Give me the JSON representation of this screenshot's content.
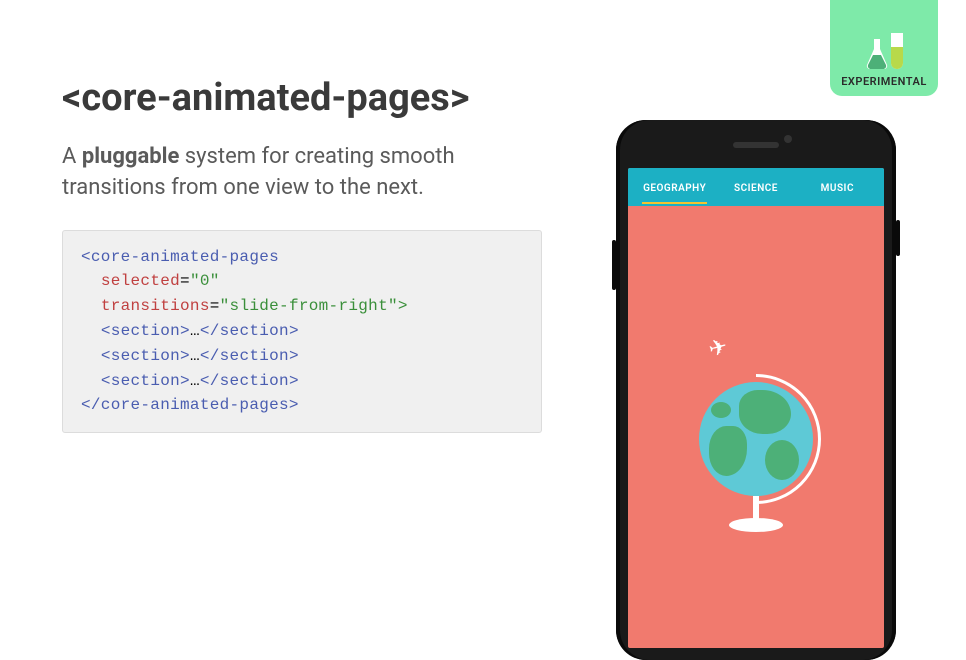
{
  "badge": {
    "label": "EXPERIMENTAL"
  },
  "heading": "<core-animated-pages>",
  "subtitle_prefix": "A ",
  "subtitle_bold": "pluggable",
  "subtitle_suffix": " system for creating smooth transitions from one view to the next.",
  "code": {
    "tag_open": "<core-animated-pages",
    "attr1": "selected",
    "val1": "\"0\"",
    "attr2": "transitions",
    "val2": "\"slide-from-right\">",
    "section_open": "<section>",
    "section_ellipsis": "…",
    "section_close": "</section>",
    "tag_close": "</core-animated-pages>"
  },
  "phone": {
    "tabs": [
      {
        "label": "GEOGRAPHY",
        "active": true
      },
      {
        "label": "SCIENCE",
        "active": false
      },
      {
        "label": "MUSIC",
        "active": false
      }
    ]
  }
}
